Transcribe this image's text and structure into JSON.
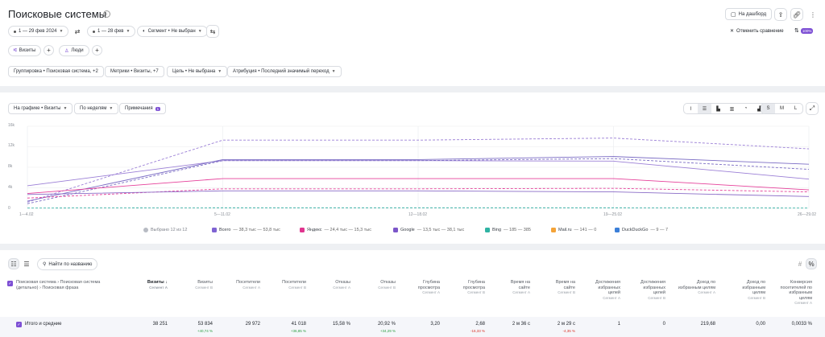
{
  "header": {
    "title": "Поисковые системы",
    "dashboard_label": "На дашборд",
    "reset_compare_label": "Отменить сравнение",
    "sampling_badge": "100%"
  },
  "filters": {
    "period_a": "1 — 29 фев 2024",
    "period_b": "1 — 28 фев",
    "segment": "Сегмент • Не выбран",
    "tag_visits": "Визиты",
    "tag_people": "Люди"
  },
  "settings": {
    "grouping": "Группировка • Поисковая система, +2",
    "metrics": "Метрики • Визиты, +7",
    "goal": "Цель • Не выбрана",
    "attribution": "Атрибуция • Последний значимый переход"
  },
  "chart_controls": {
    "on_chart": "На графике • Визиты",
    "granularity": "По неделям",
    "notes": "Примечания",
    "notes_count": "1",
    "sizes": [
      "S",
      "M",
      "L"
    ]
  },
  "chart_data": {
    "type": "line",
    "categories": [
      "1—4.02",
      "5—11.02",
      "12—18.02",
      "19—25.02",
      "26—29.02"
    ],
    "yticks": [
      "16k",
      "12k",
      "8k",
      "4k",
      "0"
    ],
    "ylim": [
      0,
      16000
    ],
    "series": [
      {
        "name": "Всего",
        "period": "A",
        "color": "#9b7fd6",
        "values": [
          4400,
          9300,
          9300,
          9200,
          5700
        ]
      },
      {
        "name": "Всего",
        "period": "B",
        "color": "#9b7fd6",
        "values": [
          1200,
          13300,
          13300,
          13700,
          11600
        ]
      },
      {
        "name": "Google",
        "period": "A",
        "color": "#7b6cc4",
        "values": [
          1400,
          9500,
          9500,
          10100,
          8600
        ]
      },
      {
        "name": "Google",
        "period": "B",
        "color": "#7b6cc4",
        "values": [
          900,
          9300,
          9300,
          9700,
          7600
        ]
      },
      {
        "name": "Яндекс",
        "period": "A",
        "color": "#e5409a",
        "values": [
          2900,
          5800,
          5800,
          5800,
          3600
        ]
      },
      {
        "name": "Яндекс",
        "period": "B",
        "color": "#e5409a",
        "values": [
          2000,
          3800,
          3800,
          3900,
          3200
        ]
      },
      {
        "name": "Bing",
        "period": "A",
        "color": "#8a6cc7",
        "values": [
          2700,
          3400,
          3400,
          3200,
          2300
        ]
      },
      {
        "name": "Bing",
        "period": "B",
        "color": "#3fb3a8",
        "values": [
          50,
          100,
          100,
          100,
          50
        ]
      }
    ]
  },
  "legend": {
    "selected": "Выбрано 12 из 12",
    "items": [
      {
        "name": "Всего",
        "values": "— 38,3 тыс   — 53,8 тыс",
        "color": "#7f63d3"
      },
      {
        "name": "Яндекс",
        "values": "— 24,4 тыс   — 15,3 тыс",
        "color": "#e0358f"
      },
      {
        "name": "Google",
        "values": "— 13,5 тыс   — 38,1 тыс",
        "color": "#7c56c9"
      },
      {
        "name": "Bing",
        "values": "— 185   — 385",
        "color": "#2fb3a3"
      },
      {
        "name": "Mail.ru",
        "values": "— 141   — 0",
        "color": "#f4a338"
      },
      {
        "name": "DuckDuckGo",
        "values": "— 9   — 7",
        "color": "#3b7fd8"
      }
    ]
  },
  "table": {
    "search_label": "Найти по названию",
    "dim_header": "Поисковая система › Поисковая система (детально) › Поисковая фраза",
    "columns": [
      {
        "label": "Визиты",
        "sub": "Сегмент A"
      },
      {
        "label": "Визиты",
        "sub": "Сегмент B"
      },
      {
        "label": "Посетители",
        "sub": "Сегмент A"
      },
      {
        "label": "Посетители",
        "sub": "Сегмент B"
      },
      {
        "label": "Отказы",
        "sub": "Сегмент A"
      },
      {
        "label": "Отказы",
        "sub": "Сегмент B"
      },
      {
        "label": "Глубина просмотра",
        "sub": "Сегмент A"
      },
      {
        "label": "Глубина просмотра",
        "sub": "Сегмент B"
      },
      {
        "label": "Время на сайте",
        "sub": "Сегмент A"
      },
      {
        "label": "Время на сайте",
        "sub": "Сегмент B"
      },
      {
        "label": "Достижения избранных целей",
        "sub": "Сегмент A"
      },
      {
        "label": "Достижения избранных целей",
        "sub": "Сегмент B"
      },
      {
        "label": "Доход по избранным целям",
        "sub": "Сегмент A"
      },
      {
        "label": "Доход по избранным целям",
        "sub": "Сегмент B"
      },
      {
        "label": "Конверсия посетителей по избранным целям",
        "sub": "Сегмент A"
      }
    ],
    "totals_label": "Итого и средние",
    "totals": [
      "38 251",
      "53 834",
      "29 972",
      "41 018",
      "15,58 %",
      "20,92 %",
      "3,20",
      "2,68",
      "2 м 36 с",
      "2 м 29 с",
      "1",
      "0",
      "219,68",
      "0,00",
      "0,0033 %"
    ],
    "deltas": [
      "",
      "+40,74 %",
      "",
      "+36,85 %",
      "",
      "+34,29 %",
      "",
      "-16,33 %",
      "",
      "-4,35 %",
      "",
      "",
      "",
      "",
      ""
    ]
  }
}
